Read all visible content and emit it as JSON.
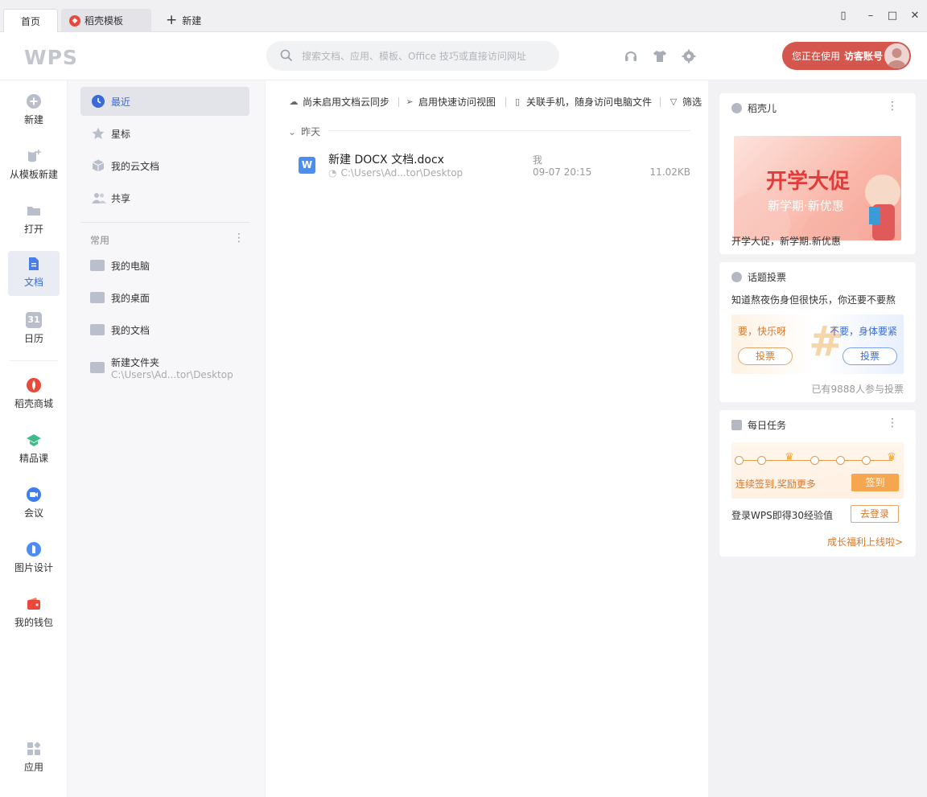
{
  "tabs": {
    "home": "首页",
    "daoke": "稻壳模板",
    "new": "新建",
    "new_icon": "plus-icon"
  },
  "header": {
    "logo": "WPS",
    "search_placeholder": "搜索文档、应用、模板、Office 技巧或直接访问网址",
    "user_prefix": "您正在使用",
    "user_account": "访客账号",
    "accent": "#d4564c"
  },
  "rail": {
    "items": [
      {
        "label": "新建",
        "icon": "plus-circle-icon"
      },
      {
        "label": "从模板新建",
        "icon": "template-icon"
      },
      {
        "label": "打开",
        "icon": "folder-icon"
      },
      {
        "label": "文档",
        "icon": "document-icon"
      },
      {
        "label": "日历",
        "icon": "calendar-icon",
        "icon_text": "31"
      },
      {
        "label": "稻壳商城",
        "icon": "daoke-icon"
      },
      {
        "label": "精品课",
        "icon": "course-icon"
      },
      {
        "label": "会议",
        "icon": "meeting-icon"
      },
      {
        "label": "图片设计",
        "icon": "image-design-icon"
      },
      {
        "label": "我的钱包",
        "icon": "wallet-icon"
      },
      {
        "label": "应用",
        "icon": "apps-icon"
      }
    ]
  },
  "nav": {
    "items": [
      {
        "label": "最近",
        "icon": "clock-icon"
      },
      {
        "label": "星标",
        "icon": "star-icon"
      },
      {
        "label": "我的云文档",
        "icon": "cube-icon"
      },
      {
        "label": "共享",
        "icon": "people-icon"
      }
    ],
    "common_title": "常用",
    "common": [
      {
        "label": "我的电脑"
      },
      {
        "label": "我的桌面"
      },
      {
        "label": "我的文档"
      },
      {
        "label": "新建文件夹",
        "path": "C:\\Users\\Ad...tor\\Desktop"
      }
    ]
  },
  "toolbar": {
    "sync": "尚未启用文档云同步",
    "quick": "启用快速访问视图",
    "phone": "关联手机，随身访问电脑文件",
    "filter": "筛选"
  },
  "files": {
    "group": "昨天",
    "rows": [
      {
        "name": "新建 DOCX 文档.docx",
        "path": "C:\\Users\\Ad...tor\\Desktop",
        "owner": "我",
        "time": "09-07 20:15",
        "size": "11.02KB"
      }
    ]
  },
  "cards": {
    "daoke": {
      "title": "稻壳儿",
      "promo_title": "开学大促",
      "promo_sub": "新学期·新优惠",
      "caption": "开学大促，新学期.新优惠"
    },
    "vote": {
      "title": "话题投票",
      "question": "知道熬夜伤身但很快乐，你还要不要熬",
      "left": "要，快乐呀",
      "right": "不要，身体要紧",
      "btn": "投票",
      "count": "已有9888人参与投票"
    },
    "task": {
      "title": "每日任务",
      "desc": "连续签到,奖励更多",
      "sign": "签到",
      "login_text": "登录WPS即得30经验值",
      "login_btn": "去登录",
      "link": "成长福利上线啦>"
    }
  }
}
